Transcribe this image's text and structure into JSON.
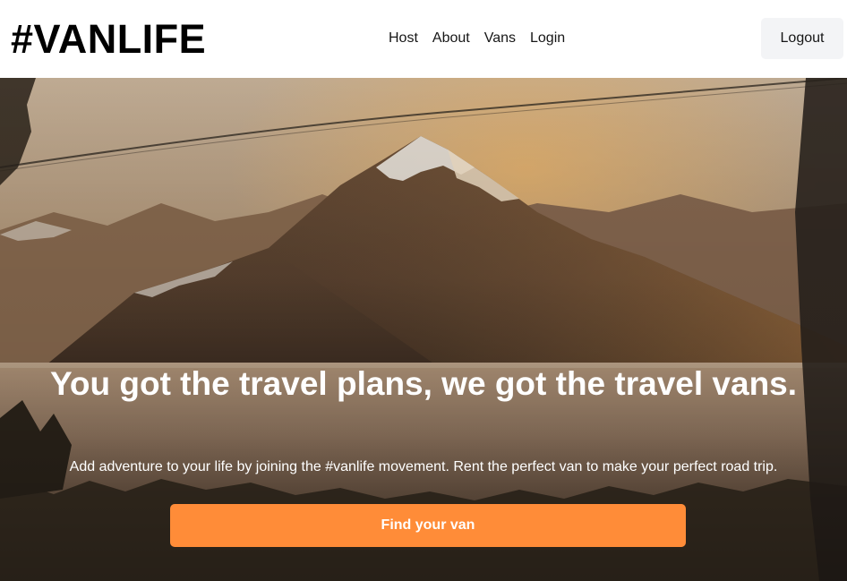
{
  "header": {
    "logo": "#VANLIFE",
    "nav": {
      "host": "Host",
      "about": "About",
      "vans": "Vans",
      "login": "Login"
    },
    "logout_label": "Logout"
  },
  "hero": {
    "title": "You got the travel plans, we got the travel vans.",
    "subtitle": "Add adventure to your life by joining the #vanlife movement. Rent the perfect van to make your perfect road trip.",
    "cta_label": "Find your van",
    "image": "mountain-lake-landscape-photo"
  },
  "colors": {
    "accent": "#FF8C38",
    "header_bg": "#FFFFFF",
    "logout_bg": "#F3F4F6",
    "text_dark": "#161616",
    "hero_text": "#FFFFFF"
  }
}
